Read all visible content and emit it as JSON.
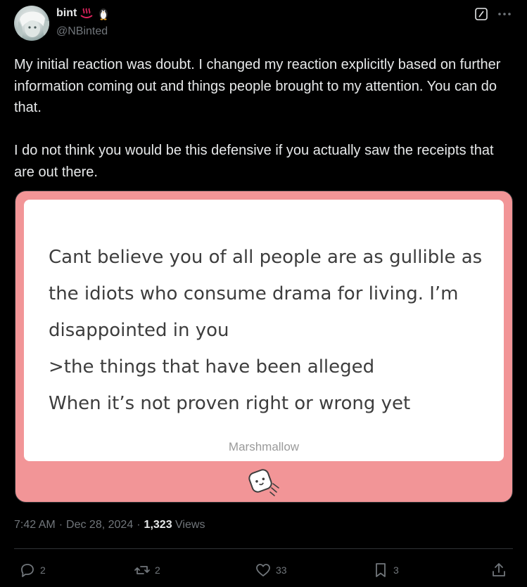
{
  "author": {
    "display_name": "bint",
    "handle": "@NBinted",
    "name_emojis": [
      "hot-springs-icon",
      "penguin-icon"
    ]
  },
  "tweet": {
    "text": "My initial reaction was doubt. I changed my reaction explicitly based on further information coming out and things people brought to my attention. You can do that.\n\nI do not think you would be this defensive if you actually saw the receipts that are out there."
  },
  "media": {
    "message": "Cant believe you of all people are as gullible as the idiots who consume drama for living. I’m disappointed in you\n>the things that have been alleged\nWhen it’s not proven right or wrong yet",
    "brand": "Marshmallow",
    "background_color": "#f29597"
  },
  "meta": {
    "time": "7:42 AM",
    "date": "Dec 28, 2024",
    "views_count": "1,323",
    "views_label": "Views"
  },
  "actions": {
    "replies": "2",
    "reposts": "2",
    "likes": "33",
    "bookmarks": "3"
  },
  "colors": {
    "background": "#000000",
    "text": "#e7e9ea",
    "secondary": "#71767b"
  }
}
